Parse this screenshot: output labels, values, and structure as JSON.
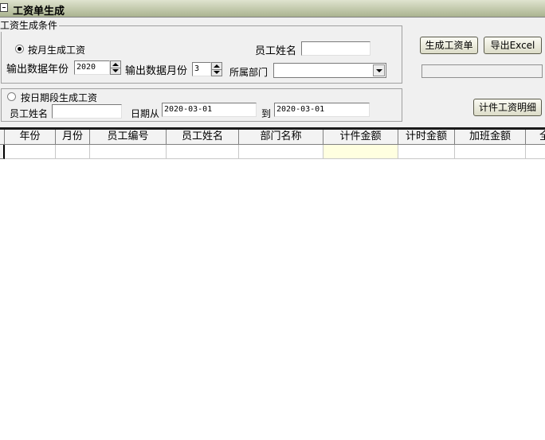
{
  "window": {
    "title": "工资单生成"
  },
  "conditions": {
    "group_label": "工资生成条件",
    "by_month": {
      "radio_label": "按月生成工资",
      "selected": true,
      "employee_name_label": "员工姓名",
      "employee_name_value": "",
      "year_label": "输出数据年份",
      "year_value": "2020",
      "month_label": "输出数据月份",
      "month_value": "3",
      "department_label": "所属部门",
      "department_value": ""
    },
    "by_date": {
      "radio_label": "按日期段生成工资",
      "selected": false,
      "employee_name_label": "员工姓名",
      "employee_name_value": "",
      "date_from_label": "日期从",
      "date_from_value": "2020-03-01",
      "date_to_label": "到",
      "date_to_value": "2020-03-01"
    }
  },
  "buttons": {
    "generate": "生成工资单",
    "export": "导出Excel",
    "piecework_detail": "计件工资明细"
  },
  "progress": {
    "value": 0
  },
  "table": {
    "columns": [
      "年份",
      "月份",
      "员工编号",
      "员工姓名",
      "部门名称",
      "计件金额",
      "计时金额",
      "加班金额",
      "全"
    ]
  }
}
